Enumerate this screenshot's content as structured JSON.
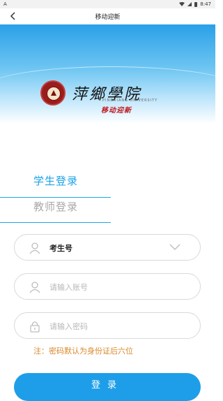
{
  "status_bar": {
    "left_icon": "A",
    "time": "8:47"
  },
  "header": {
    "title": "移动迎新"
  },
  "banner": {
    "school_name": "萍鄉學院",
    "school_name_en": "PINGXIANG UNIVERSITY",
    "subtitle": "移动迎新"
  },
  "tabs": {
    "student": "学生登录",
    "teacher": "教师登录"
  },
  "form": {
    "type_select": {
      "value": "考生号"
    },
    "account": {
      "placeholder": "请输入账号"
    },
    "password": {
      "placeholder": "请输入密码"
    },
    "note": "注：密码默认为身份证后六位",
    "login_label": "登录"
  },
  "colors": {
    "accent": "#1e9ee8",
    "note": "#d9892a",
    "emblem": "#9b1c1c"
  }
}
